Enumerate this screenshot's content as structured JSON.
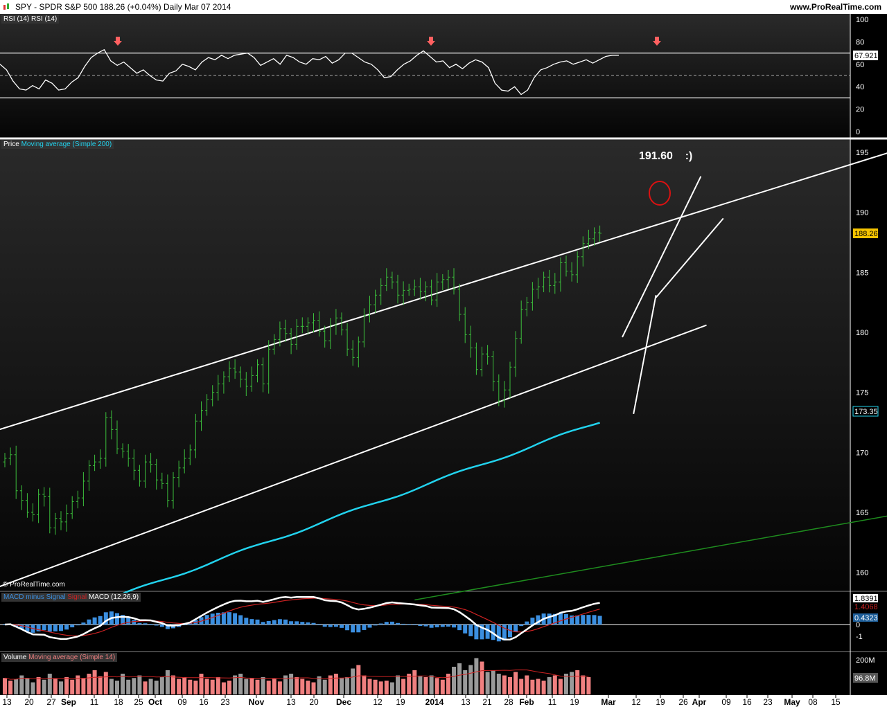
{
  "header": {
    "title": "SPY - SPDR S&P 500     188.26 (+0.04%)     Daily  Mar 07 2014",
    "brand": "www.ProRealTime.com",
    "watermark": "© ProRealTime.com"
  },
  "colors": {
    "background": "#000000",
    "price_bars": "#3cbf3c",
    "ma200": "#22d3ee",
    "trendlines": "#ffffff",
    "long_green_line": "#1e8c1e",
    "macd_hist": "#3b8fe0",
    "macd_line": "#ffffff",
    "signal_line": "#cc2222",
    "vol_up": "#f08080",
    "vol_down": "#9a9a9a",
    "price_badge": "#f5c400",
    "annotation_circle": "#dd1111",
    "arrow": "#ff6060"
  },
  "panels": {
    "rsi": {
      "labels": [
        "RSI (14)",
        "RSI (14)"
      ],
      "current": "67.921"
    },
    "price": {
      "labels": [
        "Price",
        "Moving average (Simple 200)"
      ],
      "current": "188.26",
      "ma_current": "173.35"
    },
    "macd": {
      "labels": [
        "MACD minus Signal",
        "Signal",
        "MACD (12,26,9)"
      ],
      "values": [
        "1.8391",
        "1.4068",
        "0.4323"
      ]
    },
    "volume": {
      "labels": [
        "Volume",
        "Moving average (Simple 14)"
      ],
      "values": [
        "200M",
        "96.8M"
      ]
    }
  },
  "annotation": {
    "target": "191.60",
    "smiley": ":)"
  },
  "chart_data": [
    {
      "type": "line",
      "panel": "rsi",
      "title": "RSI (14)",
      "ylim": [
        0,
        100
      ],
      "y_ticks": [
        100,
        80,
        60,
        40,
        20,
        0
      ],
      "levels": [
        70,
        50,
        30
      ],
      "values": [
        60,
        55,
        45,
        38,
        37,
        41,
        38,
        46,
        43,
        37,
        38,
        44,
        48,
        58,
        66,
        70,
        73,
        63,
        59,
        62,
        57,
        52,
        55,
        50,
        46,
        45,
        52,
        54,
        60,
        58,
        55,
        62,
        66,
        64,
        68,
        65,
        68,
        69,
        70,
        66,
        59,
        62,
        65,
        60,
        68,
        66,
        62,
        60,
        65,
        64,
        67,
        61,
        64,
        70,
        70,
        66,
        62,
        60,
        55,
        48,
        49,
        55,
        60,
        63,
        68,
        72,
        67,
        62,
        63,
        57,
        60,
        56,
        61,
        64,
        62,
        57,
        43,
        37,
        36,
        40,
        33,
        37,
        48,
        55,
        57,
        60,
        62,
        63,
        60,
        62,
        64,
        61,
        64,
        67,
        68,
        68
      ],
      "arrows_at": [
        18,
        65
      ]
    },
    {
      "type": "bar",
      "panel": "price",
      "title": "SPY - SPDR S&P 500",
      "ylim": [
        157.5,
        197.2
      ],
      "y_ticks": [
        195,
        190,
        185,
        180,
        175,
        170,
        165,
        160
      ],
      "x_tick_labels": [
        "13",
        "20",
        "27",
        "Sep",
        "11",
        "18",
        "25",
        "Oct",
        "09",
        "16",
        "23",
        "Nov",
        "13",
        "20",
        "Dec",
        "12",
        "19",
        "2014",
        "13",
        "21",
        "28",
        "Feb",
        "11",
        "19",
        "Mar",
        "12",
        "19",
        "26",
        "Apr",
        "09",
        "16",
        "23",
        "May",
        "08",
        "15"
      ],
      "close": [
        169.5,
        169.8,
        166.8,
        166.0,
        165.0,
        164.8,
        166.5,
        166.3,
        163.7,
        164.5,
        164.2,
        164.9,
        165.9,
        166.2,
        167.6,
        168.9,
        169.2,
        169.5,
        172.9,
        171.9,
        170.3,
        170.1,
        169.5,
        168.5,
        167.6,
        169.2,
        169.0,
        167.7,
        167.4,
        166.0,
        167.9,
        168.7,
        169.5,
        170.2,
        172.6,
        173.5,
        174.4,
        175.0,
        175.7,
        176.3,
        177.0,
        176.7,
        176.1,
        175.5,
        176.4,
        177.3,
        175.7,
        178.6,
        179.4,
        180.3,
        179.9,
        179.0,
        180.5,
        180.5,
        180.8,
        181.0,
        180.1,
        179.3,
        180.6,
        181.2,
        180.2,
        178.6,
        177.9,
        179.2,
        181.4,
        182.3,
        183.1,
        183.9,
        184.6,
        184.2,
        183.1,
        183.5,
        183.6,
        183.8,
        183.4,
        183.8,
        182.7,
        184.2,
        184.4,
        184.6,
        183.6,
        181.5,
        179.8,
        178.7,
        176.9,
        178.2,
        178.0,
        175.9,
        174.3,
        175.2,
        177.1,
        179.5,
        181.9,
        182.5,
        183.6,
        183.8,
        184.6,
        183.9,
        184.2,
        185.8,
        185.1,
        184.8,
        186.3,
        187.4,
        187.8,
        188.3,
        188.26
      ],
      "ma200": {
        "name": "Moving average (Simple 200)",
        "start": 158.0,
        "end": 173.35
      },
      "trendlines": [
        {
          "from": [
            -1,
            171.9
          ],
          "to": [
            170,
            196.8
          ]
        },
        {
          "from": [
            -1,
            158.8
          ],
          "to": [
            125,
            180.6
          ]
        },
        {
          "from": [
            116,
            182.9
          ],
          "to": [
            128,
            189.5
          ]
        },
        {
          "from": [
            112,
            173.2
          ],
          "to": [
            116,
            183.1
          ]
        },
        {
          "from": [
            110,
            179.6
          ],
          "to": [
            124,
            193.0
          ]
        },
        {
          "from": [
            73,
            157.7
          ],
          "to": [
            185,
            167.0
          ]
        }
      ],
      "circle_at": [
        137,
        191.6
      ]
    },
    {
      "type": "bar",
      "panel": "macd",
      "title": "MACD (12,26,9)",
      "series": [
        {
          "name": "MACD minus Signal",
          "values": "derived"
        },
        {
          "name": "Signal",
          "values": "derived"
        },
        {
          "name": "MACD (12,26,9)",
          "values": "derived"
        }
      ],
      "y_ticks": [
        0,
        -1
      ],
      "current": {
        "macd": 1.8391,
        "signal": 1.4068,
        "hist": 0.4323
      }
    },
    {
      "type": "bar",
      "panel": "volume",
      "title": "Volume",
      "y_ticks": [
        "200M"
      ],
      "ma14_current": "96.8M",
      "values_millions": [
        95,
        80,
        90,
        110,
        95,
        70,
        100,
        85,
        120,
        90,
        75,
        100,
        85,
        110,
        95,
        120,
        140,
        105,
        130,
        90,
        80,
        120,
        85,
        95,
        110,
        75,
        90,
        80,
        100,
        140,
        110,
        90,
        100,
        85,
        80,
        120,
        90,
        85,
        100,
        70,
        80,
        110,
        120,
        90,
        95,
        85,
        100,
        80,
        90,
        75,
        110,
        120,
        100,
        90,
        80,
        70,
        105,
        85,
        110,
        120,
        95,
        100,
        150,
        170,
        110,
        90,
        85,
        75,
        80,
        70,
        110,
        90,
        120,
        140,
        105,
        100,
        110,
        95,
        85,
        120,
        160,
        180,
        140,
        170,
        210,
        190,
        130,
        140,
        120,
        110,
        100,
        130,
        90,
        110,
        85,
        90,
        80,
        100,
        110,
        90,
        120,
        130,
        140,
        110,
        100
      ]
    }
  ]
}
